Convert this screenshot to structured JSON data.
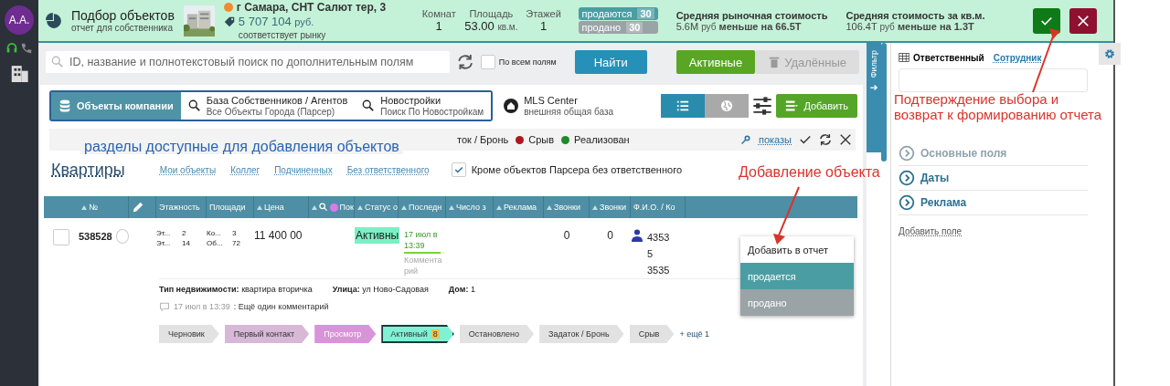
{
  "sidebar": {
    "avatar": "A.A."
  },
  "report": {
    "title": "Подбор объектов",
    "subtitle": "отчет для собственника",
    "address": "г Самара, СНТ Салют тер, 3",
    "price": "5 707 104",
    "currency": "руб.",
    "price_note": "соответствует рынку",
    "stats": [
      {
        "label": "Комнат",
        "value": "1"
      },
      {
        "label": "Площадь",
        "value": "53.00",
        "unit": "кв.м."
      },
      {
        "label": "Этажей",
        "value": "1"
      }
    ],
    "counts": [
      {
        "label": "продаются",
        "count": "30",
        "kind": "selling"
      },
      {
        "label": "продано",
        "count": "30",
        "kind": "sold"
      }
    ],
    "prices": [
      {
        "label": "Средняя рыночная стоимость",
        "value": "5.6M",
        "unit": "руб",
        "diff": "меньше на 66.5T"
      },
      {
        "label": "Средняя стоимость за кв.м.",
        "value": "106.4T",
        "unit": "руб",
        "diff": "меньше на 1.3T"
      }
    ]
  },
  "search": {
    "placeholder": "ID, название и полнотекстовый поиск по дополнительным полям",
    "all_fields": {
      "label": "По всем полям",
      "checked": false
    },
    "find": "Найти",
    "filters": [
      {
        "label": "Активные",
        "selected": true
      },
      {
        "label": "Удалённые",
        "selected": false
      }
    ]
  },
  "sections": [
    {
      "title": "Объекты компании",
      "selected": true
    },
    {
      "title": "База Собственников / Агентов",
      "subtitle": "Все Объекты Города (Парсер)",
      "selected": false
    },
    {
      "title": "Новостройки",
      "subtitle": "Поиск По Новостройкам",
      "selected": false
    }
  ],
  "mls": {
    "title": "MLS Center",
    "subtitle": "внешняя общая база"
  },
  "views": [
    {
      "kind": "list",
      "selected": true
    },
    {
      "kind": "map",
      "selected": false
    }
  ],
  "add_button": "Добавить",
  "legend": [
    {
      "label": "ток / Бронь"
    },
    {
      "label": "Срыв",
      "color": "#b0151f"
    },
    {
      "label": "Реализован",
      "color": "#1f8a2a"
    }
  ],
  "shows_link": "показы",
  "list": {
    "title": "Квартиры",
    "links": [
      "Мои объекты",
      "Коллег",
      "Подчиненных",
      "Без ответственного"
    ],
    "parser_filter": {
      "label": "Кроме объектов Парсера без ответственного",
      "checked": true
    }
  },
  "table": {
    "columns": [
      {
        "kind": "text",
        "label": "№",
        "sortable": true
      },
      {
        "kind": "edit"
      },
      {
        "kind": "text",
        "label": "Этажность",
        "sortable": false
      },
      {
        "kind": "text",
        "label": "Площади",
        "sortable": false
      },
      {
        "kind": "text",
        "label": "Цена",
        "sortable": true
      },
      {
        "kind": "search",
        "label": "Пок",
        "sortable": true
      },
      {
        "kind": "text",
        "label": "Статус о",
        "sortable": true
      },
      {
        "kind": "text",
        "label": "Последн",
        "sortable": true
      },
      {
        "kind": "text",
        "label": "Число з",
        "sortable": true
      },
      {
        "kind": "text",
        "label": "Реклама",
        "sortable": true
      },
      {
        "kind": "text",
        "label": "Звонки",
        "sortable": true
      },
      {
        "kind": "text",
        "label": "Звонки",
        "sortable": true
      },
      {
        "kind": "text",
        "label": "Ф.И.О. / Ко",
        "sortable": false
      }
    ],
    "rows": [
      {
        "checked": false,
        "selected": false,
        "id": "538528",
        "floors": [
          {
            "label": "Эт...",
            "value": "2"
          },
          {
            "label": "Эт...",
            "value": "14"
          }
        ],
        "areas": [
          {
            "label": "Ко...",
            "value": "3"
          },
          {
            "label": "Об...",
            "value": "72"
          }
        ],
        "price": "11 400 00",
        "status": "Активны",
        "last_date": "17 июл в 13:39",
        "level": 0.9,
        "last_comment": "Комментарий",
        "calls": [
          "0",
          "0"
        ],
        "phone": [
          "4353",
          "5",
          "3535"
        ],
        "details": [
          {
            "label": "Тип недвижимости:",
            "value": "квартира вторичка"
          },
          {
            "label": "Улица:",
            "value": "ул Ново-Садовая"
          },
          {
            "label": "Дом:",
            "value": "1"
          }
        ],
        "comment": {
          "date": "17 июл в 13:39",
          "text": ": Ещё один комментарий"
        },
        "stages": [
          {
            "label": "Черновик",
            "kind": "plain",
            "selected": false
          },
          {
            "label": "Первый контакт",
            "kind": "contact",
            "selected": false
          },
          {
            "label": "Просмотр",
            "kind": "viewing",
            "selected": false
          },
          {
            "label": "Активный",
            "count": "8",
            "kind": "active",
            "selected": true
          },
          {
            "label": "Остановлено",
            "kind": "plain",
            "selected": false
          },
          {
            "label": "Задаток / Бронь",
            "kind": "plain",
            "selected": false
          },
          {
            "label": "Срыв",
            "kind": "plain",
            "selected": false
          }
        ],
        "more_stages": "+ ещё 1"
      }
    ]
  },
  "add_menu": [
    {
      "label": "Добавить в отчет",
      "kind": "plain"
    },
    {
      "label": "продается",
      "kind": "selling"
    },
    {
      "label": "продано",
      "kind": "sold"
    }
  ],
  "filter_tab": "Фильтр",
  "panel": {
    "tabs": [
      {
        "label": "Ответственный",
        "selected": true
      },
      {
        "label": "Сотрудник",
        "selected": false
      }
    ],
    "groups": [
      {
        "label": "Основные поля",
        "disabled": true
      },
      {
        "label": "Даты",
        "disabled": false
      },
      {
        "label": "Реклама",
        "disabled": false
      }
    ],
    "add_field": "Добавить поле"
  },
  "annotations": [
    {
      "text": "разделы доступные для добавления объектов",
      "color": "#2a63b0",
      "arrow": false
    },
    {
      "text": "Добавление объекта",
      "color": "#d9342b",
      "arrow": true
    },
    {
      "text": "Подтверждение выбора и возврат к формированию отчета",
      "color": "#d9342b",
      "arrow": true
    }
  ]
}
